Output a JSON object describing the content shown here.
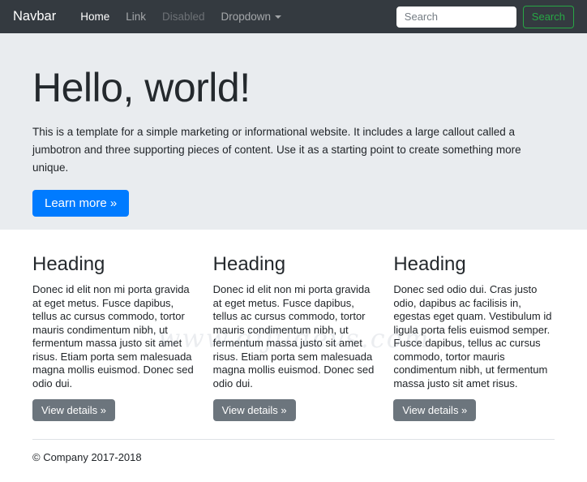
{
  "navbar": {
    "brand": "Navbar",
    "items": [
      {
        "label": "Home",
        "state": "active"
      },
      {
        "label": "Link",
        "state": "normal"
      },
      {
        "label": "Disabled",
        "state": "disabled"
      },
      {
        "label": "Dropdown",
        "state": "dropdown"
      }
    ],
    "search": {
      "placeholder": "Search",
      "button_label": "Search"
    }
  },
  "jumbotron": {
    "title": "Hello, world!",
    "lead": "This is a template for a simple marketing or informational website. It includes a large callout called a jumbotron and three supporting pieces of content. Use it as a starting point to create something more unique.",
    "cta_label": "Learn more »"
  },
  "columns": [
    {
      "heading": "Heading",
      "text": "Donec id elit non mi porta gravida at eget metus. Fusce dapibus, tellus ac cursus commodo, tortor mauris condimentum nibh, ut fermentum massa justo sit amet risus. Etiam porta sem malesuada magna mollis euismod. Donec sed odio dui.",
      "button_label": "View details »"
    },
    {
      "heading": "Heading",
      "text": "Donec id elit non mi porta gravida at eget metus. Fusce dapibus, tellus ac cursus commodo, tortor mauris condimentum nibh, ut fermentum massa justo sit amet risus. Etiam porta sem malesuada magna mollis euismod. Donec sed odio dui.",
      "button_label": "View details »"
    },
    {
      "heading": "Heading",
      "text": "Donec sed odio dui. Cras justo odio, dapibus ac facilisis in, egestas eget quam. Vestibulum id ligula porta felis euismod semper. Fusce dapibus, tellus ac cursus commodo, tortor mauris condimentum nibh, ut fermentum massa justo sit amet risus.",
      "button_label": "View details »"
    }
  ],
  "footer": {
    "copyright": "© Company 2017-2018"
  },
  "watermark": {
    "text": "www.dijildevs.com"
  },
  "colors": {
    "navbar_bg": "#343a40",
    "jumbotron_bg": "#e9ecef",
    "primary_button": "#007bff",
    "secondary_button": "#6c757d",
    "success_outline": "#28a745"
  }
}
